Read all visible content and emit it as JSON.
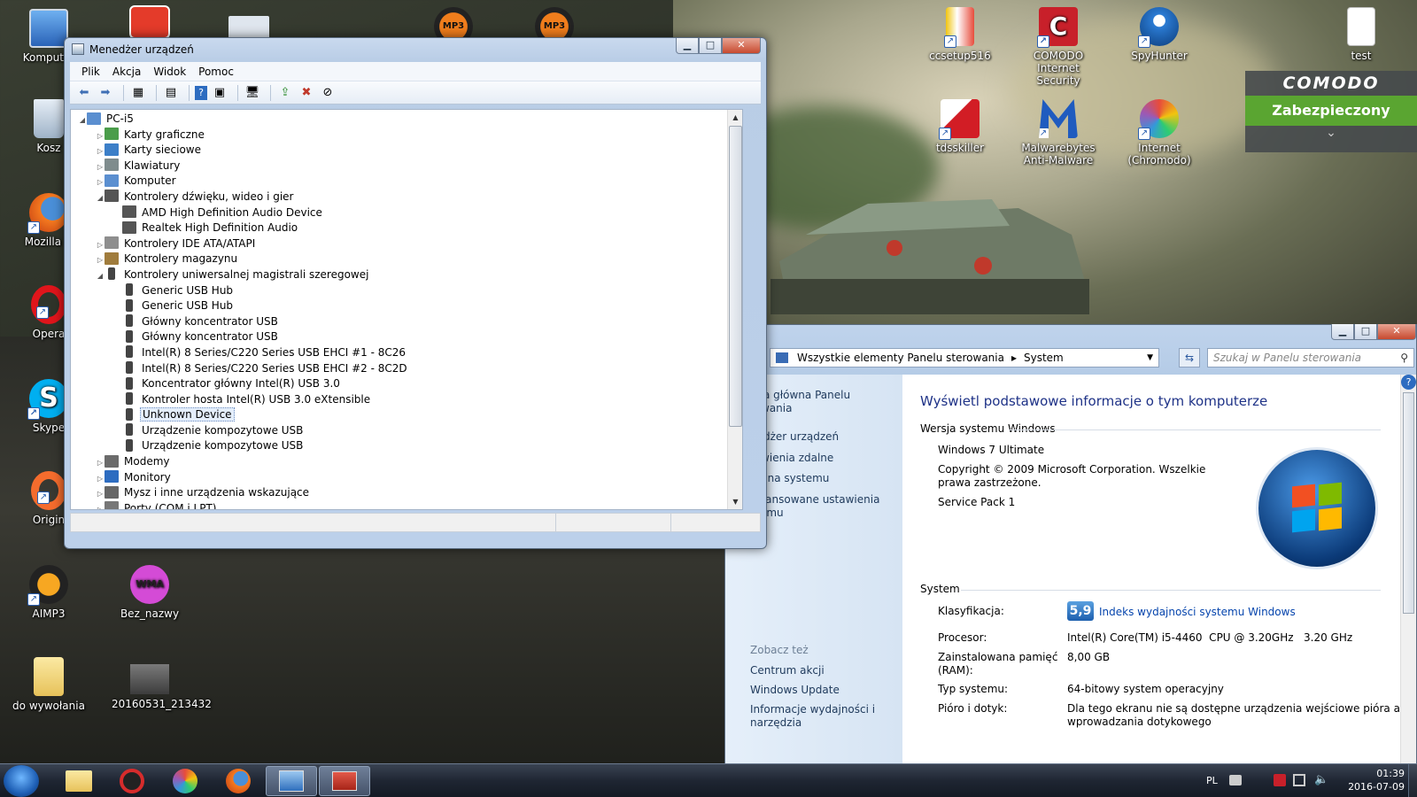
{
  "desktop": {
    "icons_left": [
      {
        "label": "Komputer",
        "icon": "computer-icon"
      },
      {
        "label": "Kosz",
        "icon": "recycle-bin-icon"
      },
      {
        "label": "Mozilla Fi",
        "icon": "firefox-icon"
      },
      {
        "label": "Opera",
        "icon": "opera-icon"
      },
      {
        "label": "Skype",
        "icon": "skype-icon"
      },
      {
        "label": "Origin",
        "icon": "origin-icon"
      },
      {
        "label": "AIMP3",
        "icon": "aimp-icon"
      },
      {
        "label": "Bez_nazwy",
        "icon": "wma-file-icon"
      },
      {
        "label": "do wywołania",
        "icon": "folder-icon"
      },
      {
        "label": "20160531_213432",
        "icon": "photo-icon"
      }
    ],
    "top_badges": [
      "MP3",
      "MP3"
    ],
    "icons_right": [
      {
        "label": "ccsetup516",
        "icon": "ccleaner-icon"
      },
      {
        "label": "COMODO Internet Security",
        "icon": "comodo-icon"
      },
      {
        "label": "SpyHunter",
        "icon": "spyhunter-icon"
      },
      {
        "label": "test",
        "icon": "text-file-icon"
      },
      {
        "label": "tdsskiller",
        "icon": "kaspersky-icon"
      },
      {
        "label": "Malwarebytes Anti-Malware",
        "icon": "malwarebytes-icon"
      },
      {
        "label": "Internet (Chromodo)",
        "icon": "chromodo-icon"
      }
    ],
    "wma_badge": "WMA"
  },
  "comodo_widget": {
    "brand": "COMODO",
    "status": "Zabezpieczony",
    "chevron": "⌄"
  },
  "devmgr": {
    "title": "Menedżer urządzeń",
    "menu": [
      "Plik",
      "Akcja",
      "Widok",
      "Pomoc"
    ],
    "tree": [
      {
        "level": 0,
        "exp": "◢",
        "label": "PC-i5",
        "icon": "computer-icon"
      },
      {
        "level": 1,
        "exp": "▷",
        "label": "Karty graficzne",
        "icon": "display-adapter-icon"
      },
      {
        "level": 1,
        "exp": "▷",
        "label": "Karty sieciowe",
        "icon": "network-adapter-icon"
      },
      {
        "level": 1,
        "exp": "▷",
        "label": "Klawiatury",
        "icon": "keyboard-icon"
      },
      {
        "level": 1,
        "exp": "▷",
        "label": "Komputer",
        "icon": "computer-icon"
      },
      {
        "level": 1,
        "exp": "◢",
        "label": "Kontrolery dźwięku, wideo i gier",
        "icon": "speaker-icon"
      },
      {
        "level": 2,
        "exp": "",
        "label": "AMD High Definition Audio Device",
        "icon": "speaker-icon"
      },
      {
        "level": 2,
        "exp": "",
        "label": "Realtek High Definition Audio",
        "icon": "speaker-icon"
      },
      {
        "level": 1,
        "exp": "▷",
        "label": "Kontrolery IDE ATA/ATAPI",
        "icon": "ide-icon"
      },
      {
        "level": 1,
        "exp": "▷",
        "label": "Kontrolery magazynu",
        "icon": "storage-icon"
      },
      {
        "level": 1,
        "exp": "◢",
        "label": "Kontrolery uniwersalnej magistrali szeregowej",
        "icon": "usb-icon"
      },
      {
        "level": 2,
        "exp": "",
        "label": "Generic USB Hub",
        "icon": "usb-icon"
      },
      {
        "level": 2,
        "exp": "",
        "label": "Generic USB Hub",
        "icon": "usb-icon"
      },
      {
        "level": 2,
        "exp": "",
        "label": "Główny koncentrator USB",
        "icon": "usb-icon"
      },
      {
        "level": 2,
        "exp": "",
        "label": "Główny koncentrator USB",
        "icon": "usb-icon"
      },
      {
        "level": 2,
        "exp": "",
        "label": "Intel(R) 8 Series/C220 Series  USB EHCI #1 - 8C26",
        "icon": "usb-icon"
      },
      {
        "level": 2,
        "exp": "",
        "label": "Intel(R) 8 Series/C220 Series  USB EHCI #2 - 8C2D",
        "icon": "usb-icon"
      },
      {
        "level": 2,
        "exp": "",
        "label": "Koncentrator główny Intel(R) USB 3.0",
        "icon": "usb-icon"
      },
      {
        "level": 2,
        "exp": "",
        "label": "Kontroler hosta Intel(R) USB 3.0 eXtensible",
        "icon": "usb-icon"
      },
      {
        "level": 2,
        "exp": "",
        "label": "Unknown Device",
        "icon": "usb-icon",
        "selected": true
      },
      {
        "level": 2,
        "exp": "",
        "label": "Urządzenie kompozytowe USB",
        "icon": "usb-icon"
      },
      {
        "level": 2,
        "exp": "",
        "label": "Urządzenie kompozytowe USB",
        "icon": "usb-icon"
      },
      {
        "level": 1,
        "exp": "▷",
        "label": "Modemy",
        "icon": "modem-icon"
      },
      {
        "level": 1,
        "exp": "▷",
        "label": "Monitory",
        "icon": "monitor-icon"
      },
      {
        "level": 1,
        "exp": "▷",
        "label": "Mysz i inne urządzenia wskazujące",
        "icon": "mouse-icon"
      },
      {
        "level": 1,
        "exp": "▷",
        "label": "Porty (COM i LPT)",
        "icon": "port-icon"
      }
    ]
  },
  "system": {
    "breadcrumb": [
      "Wszystkie elementy Panelu sterowania",
      "System"
    ],
    "search_placeholder": "Szukaj w Panelu sterowania",
    "left_links": [
      "ona główna Panelu\nrowania",
      "nedżer urządzeń",
      "tawienia zdalne",
      "hrona systemu",
      "awansowane ustawienia\nstemu"
    ],
    "see_also_title": "Zobacz też",
    "see_also": [
      "Centrum akcji",
      "Windows Update",
      "Informacje wydajności i\nnarzędzia"
    ],
    "heading": "Wyświetl podstawowe informacje o tym komputerze",
    "edition_title": "Wersja systemu Windows",
    "edition": "Windows 7 Ultimate",
    "copyright": "Copyright © 2009 Microsoft Corporation. Wszelkie prawa zastrzeżone.",
    "service_pack": "Service Pack 1",
    "system_title": "System",
    "rows": [
      {
        "k": "Klasyfikacja:",
        "v": "Indeks wydajności systemu Windows"
      },
      {
        "k": "Procesor:",
        "v": "Intel(R) Core(TM) i5-4460  CPU @ 3.20GHz   3.20 GHz"
      },
      {
        "k": "Zainstalowana pamięć\n(RAM):",
        "v": "8,00 GB"
      },
      {
        "k": "Typ systemu:",
        "v": "64-bitowy system operacyjny"
      },
      {
        "k": "Pióro i dotyk:",
        "v": "Dla tego ekranu nie są dostępne urządzenia wejściowe pióra ani\nwprowadzania dotykowego"
      }
    ],
    "wei_score": "5,9"
  },
  "taskbar": {
    "lang": "PL",
    "time": "01:39",
    "date": "2016-07-09"
  }
}
